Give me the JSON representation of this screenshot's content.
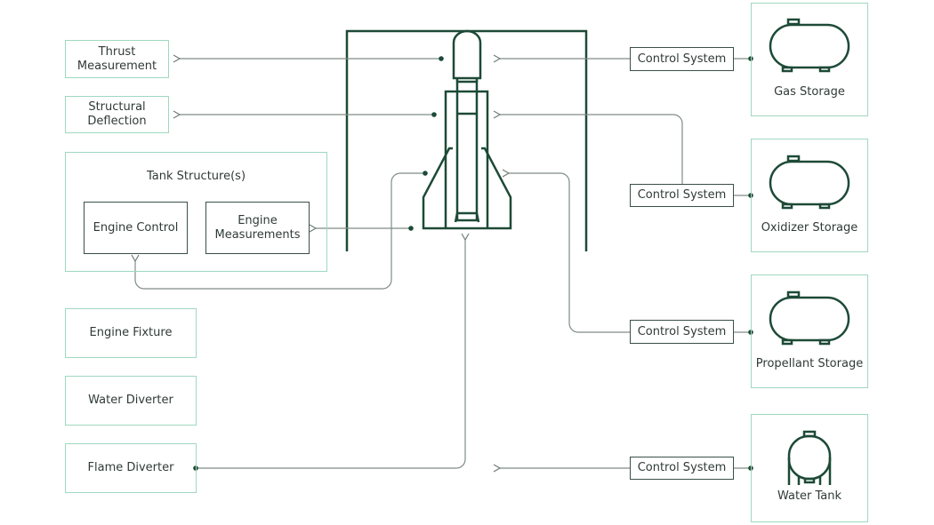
{
  "left": {
    "thrust_measurement": "Thrust Measurement",
    "structural_deflection": "Structural Deflection",
    "tank_structures": {
      "title": "Tank Structure(s)",
      "engine_control": "Engine Control",
      "engine_measurements": "Engine Measurements"
    },
    "engine_fixture": "Engine Fixture",
    "water_diverter": "Water Diverter",
    "flame_diverter": "Flame Diverter"
  },
  "right": {
    "control_systems": [
      "Control System",
      "Control System",
      "Control System",
      "Control System"
    ],
    "storages": [
      {
        "label": "Gas Storage",
        "icon": "horizontal-tank-icon"
      },
      {
        "label": "Oxidizer Storage",
        "icon": "horizontal-tank-icon"
      },
      {
        "label": "Propellant Storage",
        "icon": "horizontal-tank-icon"
      },
      {
        "label": "Water Tank",
        "icon": "vertical-tank-icon"
      }
    ]
  },
  "colors": {
    "dark": "#1d4a37",
    "box_border": "#9fd8bf",
    "line": "#7f8c86"
  }
}
